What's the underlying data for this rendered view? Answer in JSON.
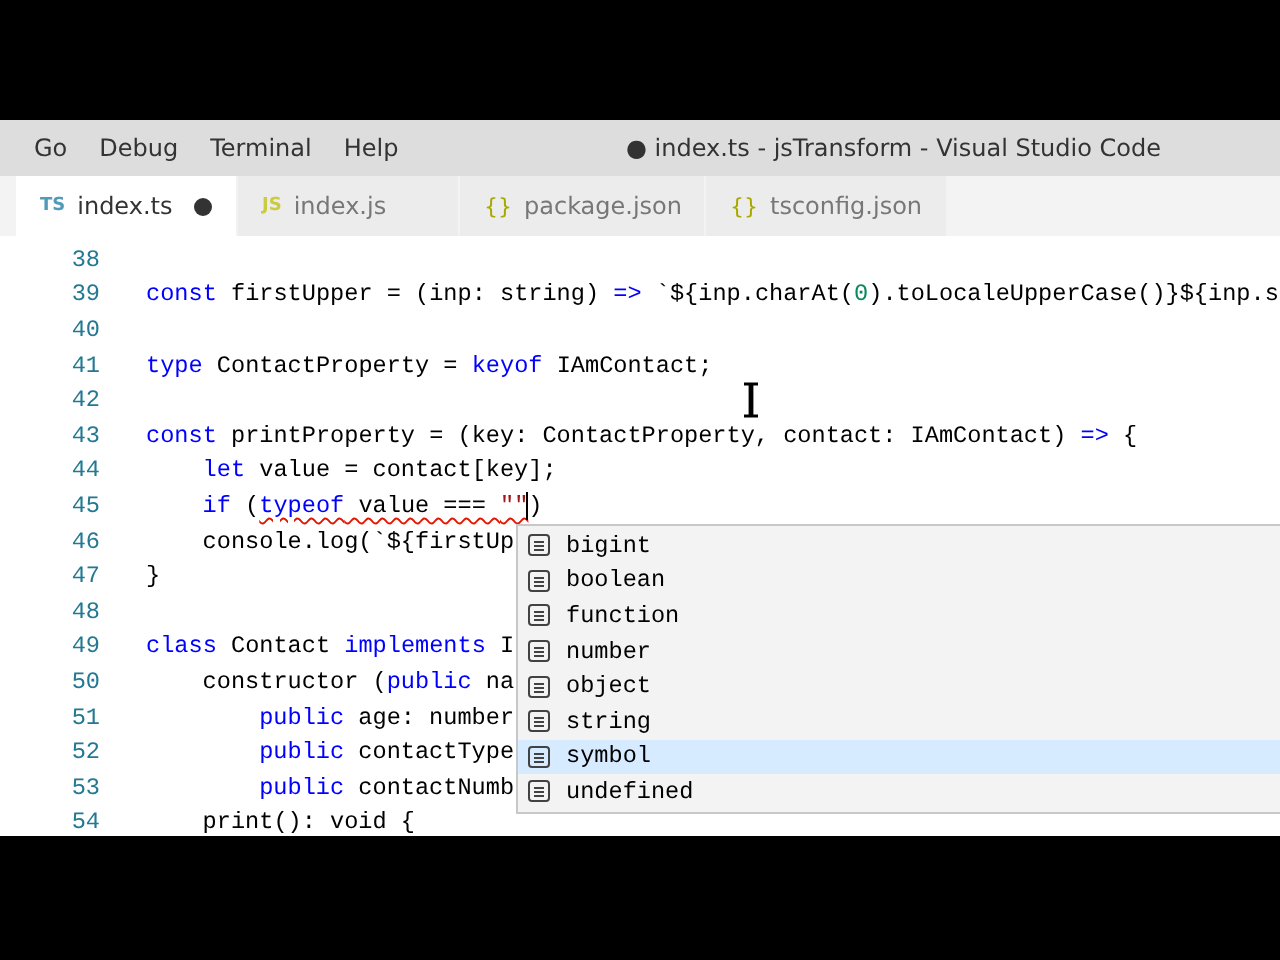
{
  "menu": [
    "Go",
    "Debug",
    "Terminal",
    "Help"
  ],
  "window": {
    "title": "● index.ts - jsTransform - Visual Studio Code"
  },
  "tabs": [
    {
      "badge": "TS",
      "kind": "ts",
      "label": "index.ts",
      "selected": true,
      "dirty": true
    },
    {
      "badge": "JS",
      "kind": "js",
      "label": "index.js",
      "selected": false,
      "dirty": false
    },
    {
      "badge": "{}",
      "kind": "json",
      "label": "package.json",
      "selected": false,
      "dirty": false
    },
    {
      "badge": "{}",
      "kind": "json",
      "label": "tsconfig.json",
      "selected": false,
      "dirty": false
    }
  ],
  "editor": {
    "lines": [
      {
        "number": "38"
      },
      {
        "number": "39",
        "tokens": [
          {
            "kind": "kw",
            "text": "const"
          },
          {
            "kind": "id",
            "text": " firstUpper = (inp: string) "
          },
          {
            "kind": "kw",
            "text": "=>"
          },
          {
            "kind": "id",
            "text": " `${inp.charAt("
          },
          {
            "kind": "num",
            "text": "0"
          },
          {
            "kind": "id",
            "text": ").toLocaleUpperCase()}${inp.s"
          }
        ]
      },
      {
        "number": "40"
      },
      {
        "number": "41",
        "tokens": [
          {
            "kind": "kw",
            "text": "type"
          },
          {
            "kind": "id",
            "text": " ContactProperty = "
          },
          {
            "kind": "kw",
            "text": "keyof"
          },
          {
            "kind": "id",
            "text": " IAmContact;"
          }
        ]
      },
      {
        "number": "42"
      },
      {
        "number": "43",
        "tokens": [
          {
            "kind": "kw",
            "text": "const"
          },
          {
            "kind": "id",
            "text": " printProperty = (key: ContactProperty, contact: IAmContact) "
          },
          {
            "kind": "kw",
            "text": "=>"
          },
          {
            "kind": "id",
            "text": " {"
          }
        ],
        "children": [
          {
            "number": "44",
            "tokens": [
              {
                "kind": "kw",
                "text": "let"
              },
              {
                "kind": "id",
                "text": " value = contact[key];"
              }
            ]
          },
          {
            "number": "45",
            "tokens": [
              {
                "kind": "kw",
                "text": "if"
              },
              {
                "kind": "id",
                "text": " ("
              },
              {
                "kind": "error",
                "children": [
                  {
                    "kind": "kw",
                    "text": "typeof"
                  },
                  {
                    "kind": "id",
                    "text": " value === "
                  },
                  {
                    "kind": "str",
                    "text": "\"\""
                  }
                ]
              },
              {
                "kind": "id",
                "text": ")"
              }
            ],
            "caret": true
          },
          {
            "number": "46",
            "tokens": [
              {
                "kind": "id",
                "text": "console.log(`${firstUp"
              }
            ]
          }
        ]
      },
      {
        "number": "47",
        "tokens": [
          {
            "kind": "id",
            "text": "}"
          }
        ]
      },
      {
        "number": "48"
      },
      {
        "number": "49",
        "tokens": [
          {
            "kind": "kw",
            "text": "class"
          },
          {
            "kind": "id",
            "text": " Contact "
          },
          {
            "kind": "kw",
            "text": "implements"
          },
          {
            "kind": "id",
            "text": " I"
          }
        ],
        "children": [
          {
            "number": "50",
            "tokens": [
              {
                "kind": "id",
                "text": "constructor ("
              },
              {
                "kind": "kw",
                "text": "public"
              },
              {
                "kind": "id",
                "text": " na"
              }
            ],
            "children": [
              {
                "number": "51",
                "tokens": [
                  {
                    "kind": "kw",
                    "text": "public"
                  },
                  {
                    "kind": "id",
                    "text": " age: number"
                  }
                ]
              },
              {
                "number": "52",
                "tokens": [
                  {
                    "kind": "kw",
                    "text": "public"
                  },
                  {
                    "kind": "id",
                    "text": " contactType"
                  }
                ]
              },
              {
                "number": "53",
                "tokens": [
                  {
                    "kind": "kw",
                    "text": "public"
                  },
                  {
                    "kind": "id",
                    "text": " contactNumb"
                  }
                ]
              }
            ]
          },
          {
            "number": "54",
            "tokens": [
              {
                "kind": "id",
                "text": "print(): void {"
              }
            ]
          }
        ]
      }
    ]
  },
  "suggestions": [
    {
      "label": "bigint",
      "selected": false
    },
    {
      "label": "boolean",
      "selected": false
    },
    {
      "label": "function",
      "selected": false
    },
    {
      "label": "number",
      "selected": false
    },
    {
      "label": "object",
      "selected": false
    },
    {
      "label": "string",
      "selected": false
    },
    {
      "label": "symbol",
      "selected": true
    },
    {
      "label": "undefined",
      "selected": false
    }
  ]
}
